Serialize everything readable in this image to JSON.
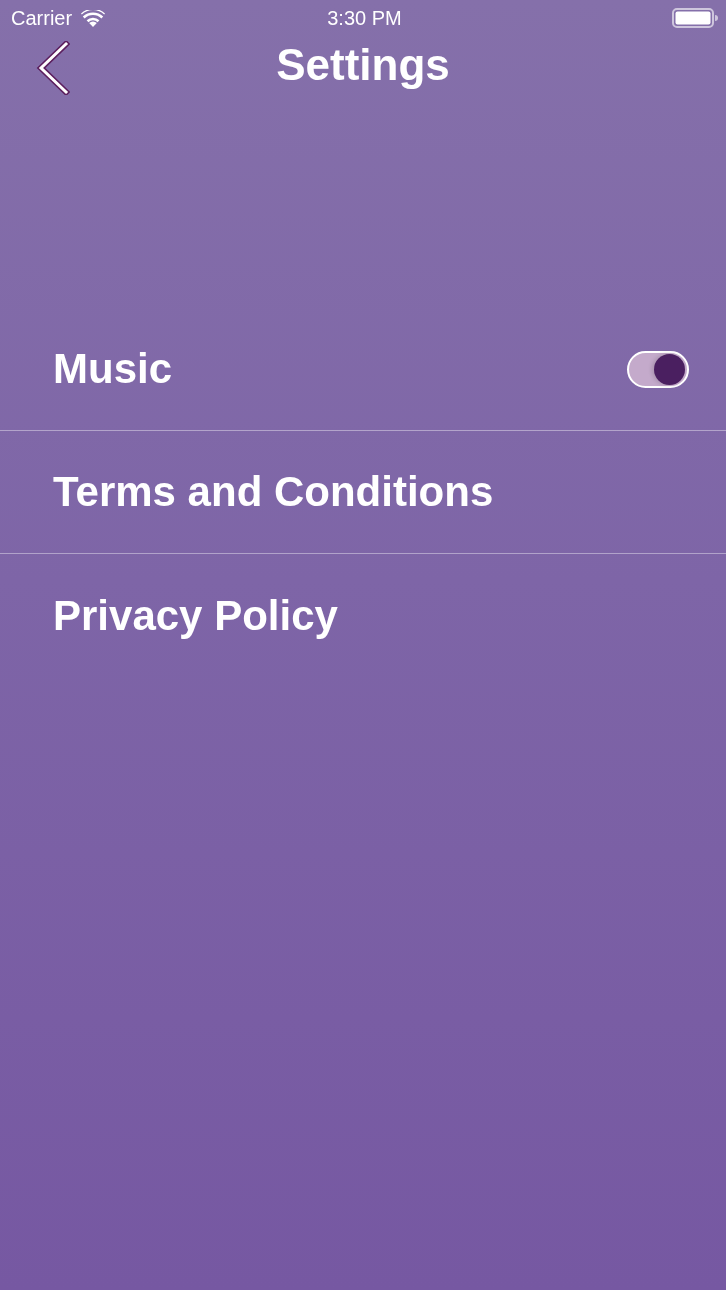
{
  "status_bar": {
    "carrier": "Carrier",
    "time": "3:30 PM"
  },
  "nav": {
    "title": "Settings"
  },
  "rows": [
    {
      "kind": "toggle",
      "label": "Music",
      "on": true
    },
    {
      "kind": "link",
      "label": "Terms and Conditions"
    },
    {
      "kind": "link",
      "label": "Privacy Policy"
    }
  ]
}
